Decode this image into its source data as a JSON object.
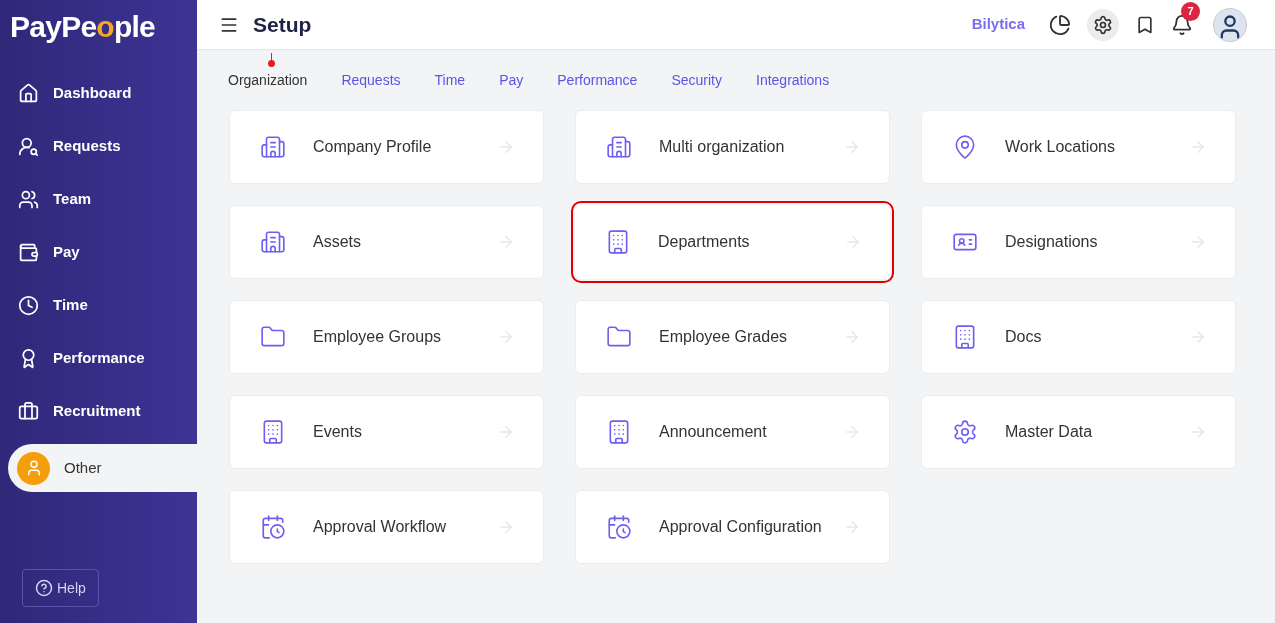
{
  "brand": {
    "text_start": "PayPe",
    "text_o": "o",
    "text_end": "ple"
  },
  "sidebar": {
    "items": [
      {
        "label": "Dashboard",
        "kind": "home",
        "selected": false
      },
      {
        "label": "Requests",
        "kind": "request",
        "selected": false
      },
      {
        "label": "Team",
        "kind": "team",
        "selected": false
      },
      {
        "label": "Pay",
        "kind": "wallet",
        "selected": false
      },
      {
        "label": "Time",
        "kind": "clock",
        "selected": false
      },
      {
        "label": "Performance",
        "kind": "award",
        "selected": false
      },
      {
        "label": "Recruitment",
        "kind": "briefcase",
        "selected": false
      },
      {
        "label": "Other",
        "kind": "user",
        "selected": true
      }
    ],
    "help": "Help"
  },
  "header": {
    "title": "Setup",
    "company": "Bilytica",
    "notification_count": "7"
  },
  "tabs": [
    {
      "label": "Organization",
      "selected": true
    },
    {
      "label": "Requests",
      "selected": false
    },
    {
      "label": "Time",
      "selected": false
    },
    {
      "label": "Pay",
      "selected": false
    },
    {
      "label": "Performance",
      "selected": false
    },
    {
      "label": "Security",
      "selected": false
    },
    {
      "label": "Integrations",
      "selected": false
    }
  ],
  "cards": [
    {
      "label": "Company Profile",
      "kind": "buildings",
      "highlighted": false
    },
    {
      "label": "Multi organization",
      "kind": "buildings",
      "highlighted": false
    },
    {
      "label": "Work Locations",
      "kind": "pin",
      "highlighted": false
    },
    {
      "label": "Assets",
      "kind": "buildings",
      "highlighted": false
    },
    {
      "label": "Departments",
      "kind": "tower",
      "highlighted": true
    },
    {
      "label": "Designations",
      "kind": "idcard",
      "highlighted": false
    },
    {
      "label": "Employee Groups",
      "kind": "folder",
      "highlighted": false
    },
    {
      "label": "Employee Grades",
      "kind": "folder",
      "highlighted": false
    },
    {
      "label": "Docs",
      "kind": "tower",
      "highlighted": false
    },
    {
      "label": "Events",
      "kind": "tower",
      "highlighted": false
    },
    {
      "label": "Announcement",
      "kind": "tower",
      "highlighted": false
    },
    {
      "label": "Master Data",
      "kind": "gear",
      "highlighted": false
    },
    {
      "label": "Approval Workflow",
      "kind": "calendar",
      "highlighted": false
    },
    {
      "label": "Approval Configuration",
      "kind": "calendar",
      "highlighted": false
    }
  ]
}
